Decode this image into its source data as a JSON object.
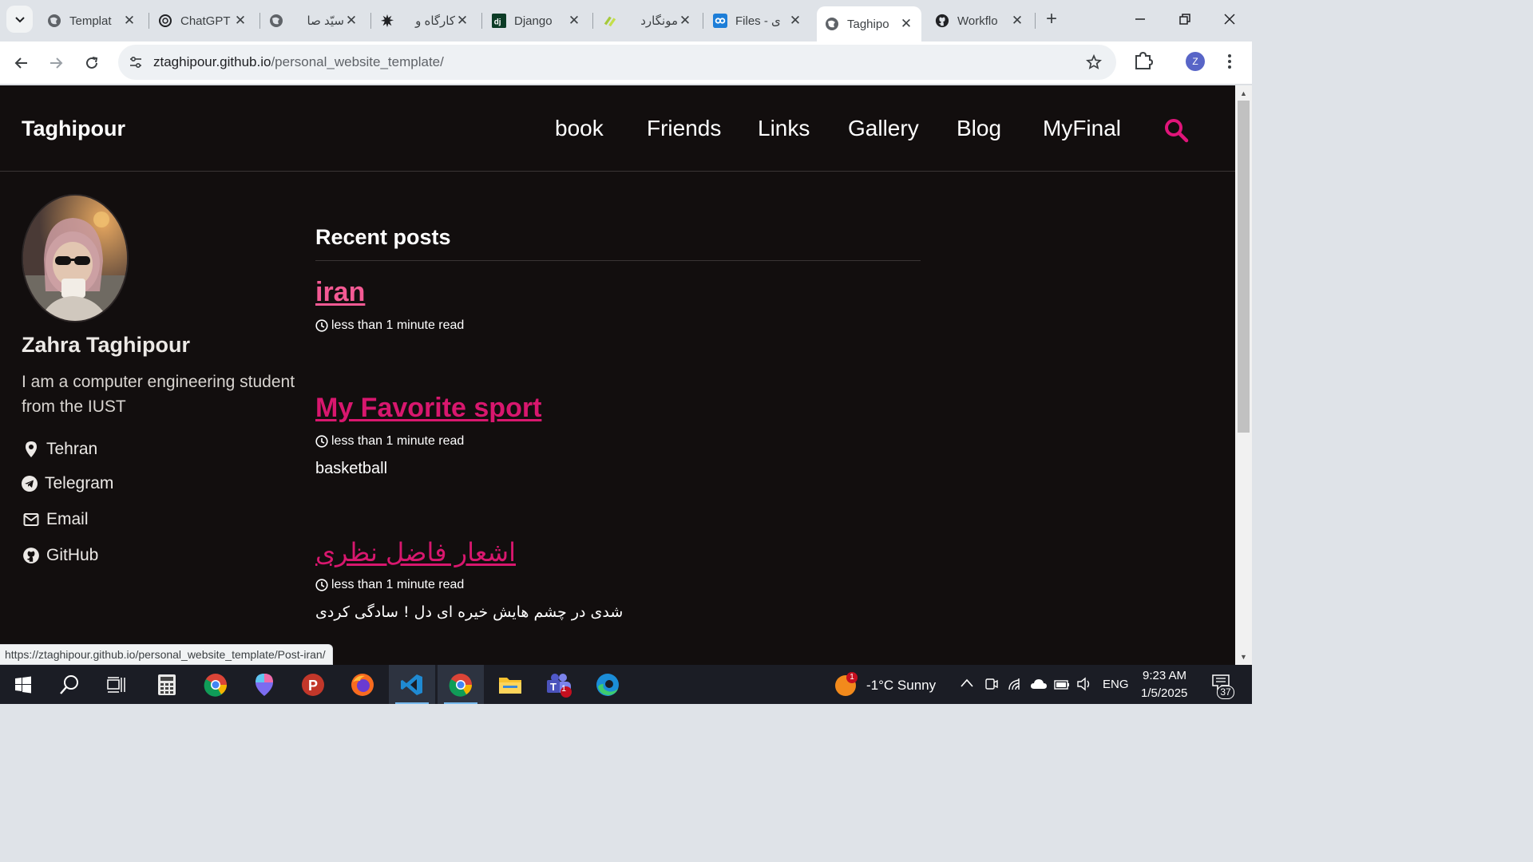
{
  "browser": {
    "tabs": [
      {
        "title": "Templat",
        "favicon": "globe-icon",
        "active": false
      },
      {
        "title": "ChatGPT",
        "favicon": "openai-icon",
        "active": false
      },
      {
        "title": "سیّد صا",
        "favicon": "globe-icon",
        "active": false
      },
      {
        "title": "کارگاه و",
        "favicon": "gear-logo-icon",
        "active": false
      },
      {
        "title": "Django",
        "favicon": "django-icon",
        "active": false
      },
      {
        "title": "مونگارد",
        "favicon": "mongard-icon",
        "active": false
      },
      {
        "title": "Files - ی",
        "favicon": "quera-icon",
        "active": false
      },
      {
        "title": "Taghipo",
        "favicon": "globe-icon",
        "active": true
      },
      {
        "title": "Workflo",
        "favicon": "github-icon",
        "active": false
      }
    ],
    "url_host": "ztaghipour.github.io",
    "url_path": "/personal_website_template/",
    "profile_initial": "Z",
    "status_url": "https://ztaghipour.github.io/personal_website_template/Post-iran/"
  },
  "site": {
    "title": "Taghipour",
    "nav": [
      "book",
      "Friends",
      "Links",
      "Gallery",
      "Blog",
      "MyFinal"
    ],
    "accent_color": "#e0157a"
  },
  "author": {
    "name": "Zahra Taghipour",
    "bio": "I am a computer engineering student from the IUST",
    "links": [
      {
        "label": "Tehran",
        "icon": "location-pin-icon"
      },
      {
        "label": "Telegram",
        "icon": "telegram-icon"
      },
      {
        "label": "Email",
        "icon": "envelope-icon"
      },
      {
        "label": "GitHub",
        "icon": "github-icon"
      }
    ]
  },
  "recent": {
    "heading": "Recent posts",
    "posts": [
      {
        "title": "iran",
        "read_time": "less than 1 minute read",
        "excerpt": "",
        "color": "#f45a94"
      },
      {
        "title": "My Favorite sport",
        "read_time": "less than 1 minute read",
        "excerpt": "basketball",
        "color": "#d8176e"
      },
      {
        "title": "اشعار فاضل نظری",
        "read_time": "less than 1 minute read",
        "excerpt": "شدی در چشم هایش خیره ای دل ! سادگی کردی",
        "color": "#d8176e"
      }
    ]
  },
  "taskbar": {
    "weather_badge": "1",
    "weather": "-1°C  Sunny",
    "language": "ENG",
    "time": "9:23 AM",
    "date": "1/5/2025",
    "teams_badge": "1",
    "notifications": "37"
  }
}
